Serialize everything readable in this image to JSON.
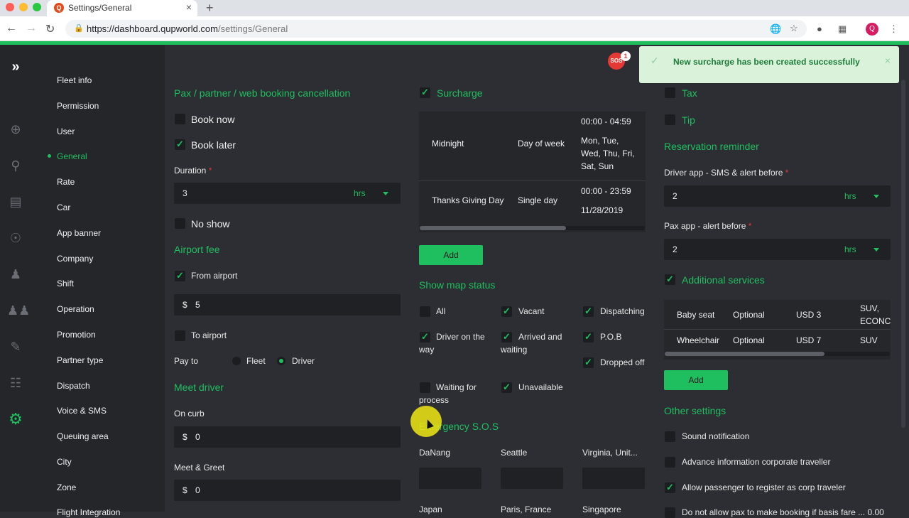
{
  "browser": {
    "tab_title": "Settings/General",
    "new_tab": "+",
    "close_tab": "×",
    "url_domain": "https://dashboard.qupworld.com",
    "url_path": "/settings/General",
    "profile_initial": "Q"
  },
  "sidebar_icons": [
    "expand-icon",
    "plus-circle-icon",
    "map-pin-icon",
    "ticket-icon",
    "steering-wheel-icon",
    "user-icon",
    "users-icon",
    "chat-icon",
    "clipboard-icon",
    "gear-icon"
  ],
  "menu": {
    "items": [
      {
        "label": "Fleet info"
      },
      {
        "label": "Permission"
      },
      {
        "label": "User"
      },
      {
        "label": "General"
      },
      {
        "label": "Rate"
      },
      {
        "label": "Car"
      },
      {
        "label": "App banner"
      },
      {
        "label": "Company"
      },
      {
        "label": "Shift"
      },
      {
        "label": "Operation"
      },
      {
        "label": "Promotion"
      },
      {
        "label": "Partner type"
      },
      {
        "label": "Dispatch"
      },
      {
        "label": "Voice & SMS"
      },
      {
        "label": "Queuing area"
      },
      {
        "label": "City"
      },
      {
        "label": "Zone"
      },
      {
        "label": "Flight Integration"
      }
    ],
    "active": "General"
  },
  "toast": {
    "message": "New surcharge has been created successfully",
    "close": "×"
  },
  "sos": {
    "label": "SOS",
    "count": "1"
  },
  "col1": {
    "cancel_title": "Pax / partner / web booking cancellation",
    "book_now": "Book now",
    "book_later": "Book later",
    "duration_label": "Duration",
    "required": "*",
    "duration_value": "3",
    "duration_unit": "hrs",
    "no_show": "No show",
    "airport_title": "Airport fee",
    "from_airport": "From airport",
    "currency": "$",
    "from_airport_value": "5",
    "to_airport": "To airport",
    "pay_to_label": "Pay to",
    "pay_fleet": "Fleet",
    "pay_driver": "Driver",
    "meet_driver_title": "Meet driver",
    "on_curb": "On curb",
    "on_curb_value": "0",
    "meet_greet": "Meet & Greet",
    "meet_greet_value": "0"
  },
  "col2": {
    "surcharge_title": "Surcharge",
    "surcharge_rows": [
      {
        "name": "Midnight",
        "type": "Day of week",
        "time": "00:00 - 04:59",
        "days": "Mon, Tue, Wed, Thu, Fri, Sat, Sun"
      },
      {
        "name": "Thanks Giving Day",
        "type": "Single day",
        "time": "00:00 - 23:59",
        "days": "11/28/2019"
      }
    ],
    "add_label": "Add",
    "map_status_title": "Show map status",
    "map_status": [
      {
        "label": "All",
        "checked": false
      },
      {
        "label": "Vacant",
        "checked": true
      },
      {
        "label": "Dispatching",
        "checked": true
      },
      {
        "label": "Driver on the way",
        "checked": true
      },
      {
        "label": "Arrived and waiting",
        "checked": true
      },
      {
        "label": "P.O.B",
        "checked": true
      },
      {
        "label": "Dropped off",
        "checked": true
      },
      {
        "label": "Waiting for process",
        "checked": false
      },
      {
        "label": "Unavailable",
        "checked": true
      }
    ],
    "sos_title": "Emergency S.O.S",
    "sos_cities": [
      "DaNang",
      "Seattle",
      "Virginia, Unit...",
      "Japan",
      "Paris, France",
      "Singapore"
    ]
  },
  "col3": {
    "tax": "Tax",
    "tip": "Tip",
    "reminder_title": "Reservation reminder",
    "driver_app_label": "Driver app - SMS & alert before",
    "driver_app_value": "2",
    "pax_app_label": "Pax app - alert before",
    "pax_app_value": "2",
    "unit": "hrs",
    "required": "*",
    "additional_title": "Additional services",
    "services": [
      {
        "name": "Baby seat",
        "type": "Optional",
        "price": "USD 3",
        "cars": "SUV, ECONC"
      },
      {
        "name": "Wheelchair",
        "type": "Optional",
        "price": "USD 7",
        "cars": "SUV"
      }
    ],
    "add_label": "Add",
    "other_title": "Other settings",
    "other": [
      {
        "label": "Sound notification",
        "checked": false
      },
      {
        "label": "Advance information corporate traveller",
        "checked": false
      },
      {
        "label": "Allow passenger to register as corp traveler",
        "checked": true
      },
      {
        "label": "Do not allow pax to make booking if basis fare ... 0.00",
        "checked": false
      }
    ]
  }
}
